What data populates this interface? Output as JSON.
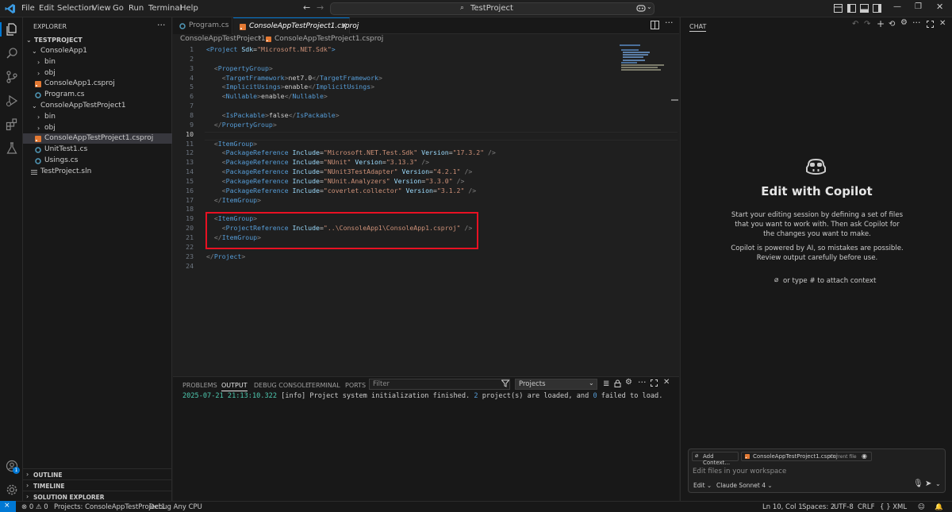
{
  "titlebar": {
    "menu": [
      "File",
      "Edit",
      "Selection",
      "View",
      "Go",
      "Run",
      "Terminal",
      "Help"
    ],
    "search_text": "TestProject"
  },
  "explorer": {
    "header": "EXPLORER",
    "root": "TESTPROJECT",
    "items": [
      {
        "label": "ConsoleApp1",
        "type": "folder-open"
      },
      {
        "label": "bin",
        "type": "folder"
      },
      {
        "label": "obj",
        "type": "folder"
      },
      {
        "label": "ConsoleApp1.csproj",
        "type": "csproj"
      },
      {
        "label": "Program.cs",
        "type": "cs"
      },
      {
        "label": "ConsoleAppTestProject1",
        "type": "folder-open"
      },
      {
        "label": "bin",
        "type": "folder"
      },
      {
        "label": "obj",
        "type": "folder"
      },
      {
        "label": "ConsoleAppTestProject1.csproj",
        "type": "csproj"
      },
      {
        "label": "UnitTest1.cs",
        "type": "cs"
      },
      {
        "label": "Usings.cs",
        "type": "cs"
      },
      {
        "label": "TestProject.sln",
        "type": "sln"
      }
    ],
    "sections": [
      "OUTLINE",
      "TIMELINE",
      "SOLUTION EXPLORER"
    ]
  },
  "editor": {
    "tabs": [
      {
        "label": "Program.cs",
        "active": false
      },
      {
        "label": "ConsoleAppTestProject1.csproj",
        "active": true
      }
    ],
    "breadcrumb": [
      "ConsoleAppTestProject1",
      "ConsoleAppTestProject1.csproj"
    ],
    "current_line": "10",
    "lines": [
      {
        "n": "1",
        "html": "<span class='tg'>&lt;Project</span> <span class='ta'>Sdk</span><span class='tt'>=</span><span class='tv'>\"Microsoft.NET.Sdk\"</span><span class='tg'>&gt;</span>"
      },
      {
        "n": "2",
        "html": ""
      },
      {
        "n": "3",
        "html": "  <span class='gray'>&lt;</span><span class='tg'>PropertyGroup</span><span class='gray'>&gt;</span>"
      },
      {
        "n": "4",
        "html": "    <span class='gray'>&lt;</span><span class='tg'>TargetFramework</span><span class='gray'>&gt;</span><span class='tt'>net7.0</span><span class='gray'>&lt;/</span><span class='tg'>TargetFramework</span><span class='gray'>&gt;</span>"
      },
      {
        "n": "5",
        "html": "    <span class='gray'>&lt;</span><span class='tg'>ImplicitUsings</span><span class='gray'>&gt;</span><span class='tt'>enable</span><span class='gray'>&lt;/</span><span class='tg'>ImplicitUsings</span><span class='gray'>&gt;</span>"
      },
      {
        "n": "6",
        "html": "    <span class='gray'>&lt;</span><span class='tg'>Nullable</span><span class='gray'>&gt;</span><span class='tt'>enable</span><span class='gray'>&lt;/</span><span class='tg'>Nullable</span><span class='gray'>&gt;</span>"
      },
      {
        "n": "7",
        "html": ""
      },
      {
        "n": "8",
        "html": "    <span class='gray'>&lt;</span><span class='tg'>IsPackable</span><span class='gray'>&gt;</span><span class='tt'>false</span><span class='gray'>&lt;/</span><span class='tg'>IsPackable</span><span class='gray'>&gt;</span>"
      },
      {
        "n": "9",
        "html": "  <span class='gray'>&lt;/</span><span class='tg'>PropertyGroup</span><span class='gray'>&gt;</span>"
      },
      {
        "n": "10",
        "html": ""
      },
      {
        "n": "11",
        "html": "  <span class='gray'>&lt;</span><span class='tg'>ItemGroup</span><span class='gray'>&gt;</span>"
      },
      {
        "n": "12",
        "html": "    <span class='gray'>&lt;</span><span class='tg'>PackageReference</span> <span class='ta'>Include</span><span class='tt'>=</span><span class='tv'>\"Microsoft.NET.Test.Sdk\"</span> <span class='ta'>Version</span><span class='tt'>=</span><span class='tv'>\"17.3.2\"</span> <span class='gray'>/&gt;</span>"
      },
      {
        "n": "13",
        "html": "    <span class='gray'>&lt;</span><span class='tg'>PackageReference</span> <span class='ta'>Include</span><span class='tt'>=</span><span class='tv'>\"NUnit\"</span> <span class='ta'>Version</span><span class='tt'>=</span><span class='tv'>\"3.13.3\"</span> <span class='gray'>/&gt;</span>"
      },
      {
        "n": "14",
        "html": "    <span class='gray'>&lt;</span><span class='tg'>PackageReference</span> <span class='ta'>Include</span><span class='tt'>=</span><span class='tv'>\"NUnit3TestAdapter\"</span> <span class='ta'>Version</span><span class='tt'>=</span><span class='tv'>\"4.2.1\"</span> <span class='gray'>/&gt;</span>"
      },
      {
        "n": "15",
        "html": "    <span class='gray'>&lt;</span><span class='tg'>PackageReference</span> <span class='ta'>Include</span><span class='tt'>=</span><span class='tv'>\"NUnit.Analyzers\"</span> <span class='ta'>Version</span><span class='tt'>=</span><span class='tv'>\"3.3.0\"</span> <span class='gray'>/&gt;</span>"
      },
      {
        "n": "16",
        "html": "    <span class='gray'>&lt;</span><span class='tg'>PackageReference</span> <span class='ta'>Include</span><span class='tt'>=</span><span class='tv'>\"coverlet.collector\"</span> <span class='ta'>Version</span><span class='tt'>=</span><span class='tv'>\"3.1.2\"</span> <span class='gray'>/&gt;</span>"
      },
      {
        "n": "17",
        "html": "  <span class='gray'>&lt;/</span><span class='tg'>ItemGroup</span><span class='gray'>&gt;</span>"
      },
      {
        "n": "18",
        "html": ""
      },
      {
        "n": "19",
        "html": "  <span class='gray'>&lt;</span><span class='tg'>ItemGroup</span><span class='gray'>&gt;</span>"
      },
      {
        "n": "20",
        "html": "    <span class='gray'>&lt;</span><span class='tg'>ProjectReference</span> <span class='ta'>Include</span><span class='tt'>=</span><span class='tv'>\"..\\ConsoleApp1\\ConsoleApp1.csproj\"</span> <span class='gray'>/&gt;</span>"
      },
      {
        "n": "21",
        "html": "  <span class='gray'>&lt;/</span><span class='tg'>ItemGroup</span><span class='gray'>&gt;</span>"
      },
      {
        "n": "22",
        "html": ""
      },
      {
        "n": "23",
        "html": "<span class='gray'>&lt;/</span><span class='tg'>Project</span><span class='gray'>&gt;</span>"
      },
      {
        "n": "24",
        "html": ""
      }
    ]
  },
  "panel": {
    "tabs": [
      "PROBLEMS",
      "OUTPUT",
      "DEBUG CONSOLE",
      "TERMINAL",
      "PORTS"
    ],
    "active_tab": "OUTPUT",
    "filter_placeholder": "Filter",
    "channel": "Projects",
    "output": {
      "timestamp": "2025-07-21 21:13:10.322",
      "level": "[info]",
      "text_a": " Project system initialization finished. ",
      "num_a": "2",
      "text_b": " project(s) are loaded, and ",
      "num_b": "0",
      "text_c": " failed to load."
    }
  },
  "chat": {
    "header": "CHAT",
    "title": "Edit with Copilot",
    "description": "Start your editing session by defining a set of files that you want to work with. Then ask Copilot for the changes you want to make.",
    "disclaimer": "Copilot is powered by AI, so mistakes are possible. Review output carefully before use.",
    "attach_hint": "or type # to attach context",
    "add_context": "Add Context...",
    "file_chip": "ConsoleAppTestProject1.csproj",
    "file_chip_tag": "Current file",
    "input_placeholder": "Edit files in your workspace",
    "mode": "Edit",
    "model": "Claude Sonnet 4"
  },
  "statusbar": {
    "errors": "0",
    "warnings": "0",
    "projects": "Projects: ConsoleAppTestProject1",
    "debug": "Debug Any CPU",
    "position": "Ln 10, Col 1",
    "spaces": "Spaces: 2",
    "encoding": "UTF-8",
    "eol": "CRLF",
    "language": "XML"
  },
  "colors": {
    "accent": "#0078d4",
    "highlight_box": "#e81123",
    "xml_tag": "#569cd6",
    "xml_attr": "#9cdcfe",
    "xml_value": "#ce9178"
  }
}
